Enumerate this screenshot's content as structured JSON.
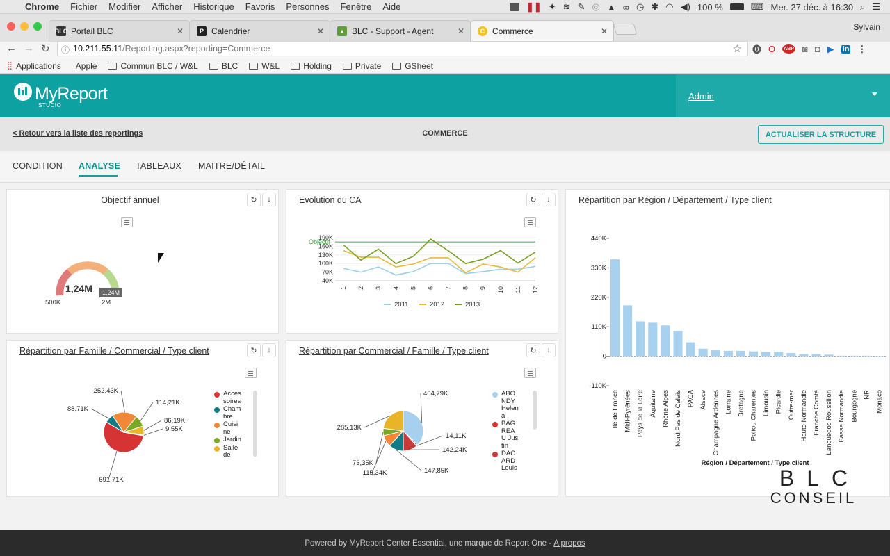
{
  "menubar": {
    "app": "Chrome",
    "items": [
      "Fichier",
      "Modifier",
      "Afficher",
      "Historique",
      "Favoris",
      "Personnes",
      "Fenêtre",
      "Aide"
    ],
    "battery": "100 %",
    "datetime": "Mer. 27 déc. à 16:30"
  },
  "tabs": [
    {
      "label": "Portail BLC"
    },
    {
      "label": "Calendrier"
    },
    {
      "label": "BLC - Support - Agent"
    },
    {
      "label": "Commerce"
    }
  ],
  "profile": "Sylvain",
  "address": {
    "host": "10.211.55.11",
    "path": "/Reporting.aspx?reporting=Commerce"
  },
  "bookmarks": [
    "Applications",
    "Apple",
    "Commun BLC / W&L",
    "BLC",
    "W&L",
    "Holding",
    "Private",
    "GSheet"
  ],
  "app": {
    "logo": "MyReport",
    "logo_sub": "STUDIO",
    "user": "Admin",
    "back_link": "< Retour vers la liste des reportings",
    "page_title": "COMMERCE",
    "refresh_button": "ACTUALISER LA STRUCTURE",
    "nav": [
      {
        "label": "CONDITION"
      },
      {
        "label": "ANALYSE"
      },
      {
        "label": "TABLEAUX"
      },
      {
        "label": "MAITRE/DÉTAIL"
      }
    ]
  },
  "panels": {
    "objectif": {
      "title": "Objectif annuel",
      "value": "1,24M",
      "min": "500K",
      "max": "2M",
      "tooltip": "1,24M"
    },
    "evolution": {
      "title": "Evolution du CA",
      "objectif_label": "Objectif",
      "y_ticks": [
        "190K",
        "160K",
        "130K",
        "100K",
        "70K",
        "40K"
      ],
      "x_ticks": [
        "1",
        "2",
        "3",
        "4",
        "5",
        "6",
        "7",
        "8",
        "9",
        "10",
        "11",
        "12"
      ]
    },
    "famille": {
      "title": "Répartition par Famille / Commercial / Type client"
    },
    "commercial": {
      "title": "Répartition par Commercial / Famille / Type client"
    },
    "region": {
      "title": "Répartition par Région / Département / Type client"
    }
  },
  "watermark": {
    "top": "BLC",
    "bottom": "CONSEIL"
  },
  "footer": {
    "text": "Powered by MyReport Center Essential, une marque de Report One - ",
    "link": "A propos"
  },
  "colors": {
    "teal": "#0ea1a1",
    "s2011": "#9ccfe8",
    "s2012": "#e8b93a",
    "s2013": "#7a9f20",
    "bar": "#a8d1f0"
  },
  "chart_data": [
    {
      "type": "line",
      "title": "Evolution du CA",
      "x": [
        1,
        2,
        3,
        4,
        5,
        6,
        7,
        8,
        9,
        10,
        11,
        12
      ],
      "ylim": [
        40,
        190
      ],
      "objectif": 175,
      "series": [
        {
          "name": "2011",
          "values": [
            83,
            70,
            88,
            60,
            72,
            100,
            100,
            65,
            72,
            80,
            80,
            90
          ]
        },
        {
          "name": "2012",
          "values": [
            145,
            122,
            122,
            88,
            98,
            120,
            120,
            68,
            98,
            88,
            70,
            120
          ]
        },
        {
          "name": "2013",
          "values": [
            165,
            112,
            150,
            100,
            125,
            185,
            145,
            100,
            115,
            145,
            102,
            140
          ]
        }
      ]
    },
    {
      "type": "pie",
      "title": "Répartition par Famille / Commercial / Type client",
      "legend": [
        "Accessoires",
        "Chambre",
        "Cuisine",
        "Jardin",
        "Salle de"
      ],
      "slices": [
        {
          "label": "691,71K",
          "value": 691.71,
          "color": "#d63434"
        },
        {
          "label": "88,71K",
          "value": 88.71,
          "color": "#117b86"
        },
        {
          "label": "252,43K",
          "value": 252.43,
          "color": "#f08838"
        },
        {
          "label": "114,21K",
          "value": 114.21,
          "color": "#7aa825"
        },
        {
          "label": "86,19K",
          "value": 86.19,
          "color": "#e9b528"
        },
        {
          "label": "9,55K",
          "value": 9.55,
          "color": "#a7cfee"
        }
      ]
    },
    {
      "type": "pie",
      "title": "Répartition par Commercial / Famille / Type client",
      "legend": [
        "ABONDY Helena",
        "BAGREAU Justin",
        "DACARD Louis"
      ],
      "slices": [
        {
          "label": "464,79K",
          "value": 464.79,
          "color": "#a7cfee"
        },
        {
          "label": "14,11K",
          "value": 14.11,
          "color": "#d63434"
        },
        {
          "label": "142,24K",
          "value": 142.24,
          "color": "#c83a3a"
        },
        {
          "label": "147,85K",
          "value": 147.85,
          "color": "#117b86"
        },
        {
          "label": "115,34K",
          "value": 115.34,
          "color": "#f08838"
        },
        {
          "label": "73,35K",
          "value": 73.35,
          "color": "#7aa825"
        },
        {
          "label": "285,13K",
          "value": 285.13,
          "color": "#e9b528"
        }
      ]
    },
    {
      "type": "bar",
      "title": "Répartition par Région / Département / Type client",
      "xlabel": "Région / Département / Type client",
      "ylim": [
        -110,
        440
      ],
      "y_ticks": [
        "440K",
        "330K",
        "220K",
        "110K",
        "0",
        "-110K"
      ],
      "categories": [
        "Ile de France",
        "Midi-Pyrénées",
        "Pays de la Loire",
        "Aquitaine",
        "Rhône Alpes",
        "Nord Pas de Calais",
        "PACA",
        "Alsace",
        "Champagne Ardennes",
        "Lorraine",
        "Bretagne",
        "Poitou Charentes",
        "Limousin",
        "Picardie",
        "Outre-mer",
        "Haute Normandie",
        "Franche Comté",
        "Languedoc Roussillon",
        "Basse Normandie",
        "Bourgogne",
        "NR",
        "Monaco"
      ],
      "values": [
        362,
        190,
        130,
        125,
        115,
        95,
        52,
        28,
        22,
        20,
        20,
        18,
        16,
        16,
        12,
        8,
        8,
        6,
        2,
        2,
        2,
        1
      ]
    }
  ]
}
